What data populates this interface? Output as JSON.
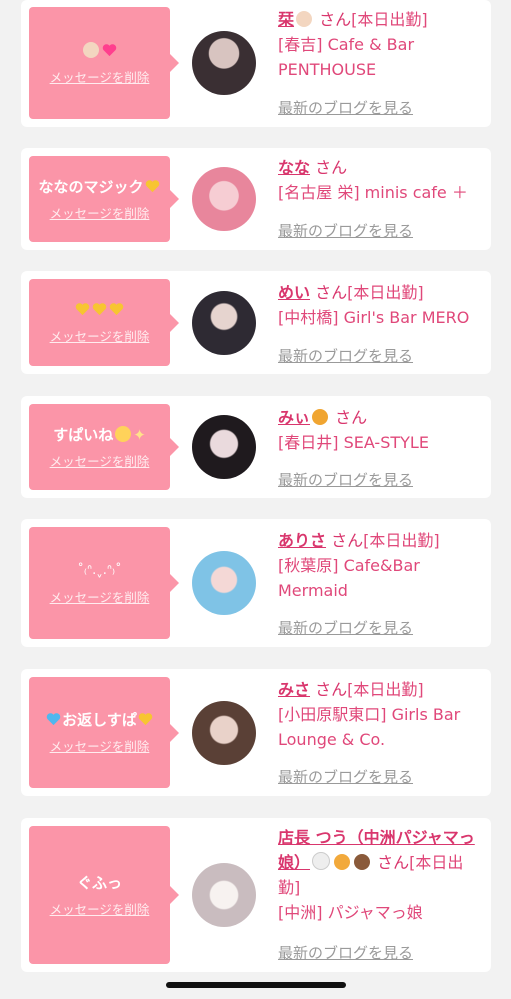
{
  "delete_label": "メッセージを削除",
  "blog_label": "最新のブログを見る",
  "san": "さん",
  "cards": [
    {
      "message": "",
      "name": "栞",
      "status": "[本日出勤]",
      "shop": "[春吉] Cafe & Bar PENTHOUSE"
    },
    {
      "message": "ななのマジック",
      "name": "なな",
      "status": "",
      "shop": "[名古屋 栄] minis cafe ＋"
    },
    {
      "message": "",
      "name": "めい",
      "status": "[本日出勤]",
      "shop": "[中村橋] Girl's Bar MERO"
    },
    {
      "message": "すぱいね",
      "name": "みぃ",
      "status": "",
      "shop": "[春日井] SEA-STYLE"
    },
    {
      "message": "˚₍ᐢ.ˬ.ᐢ₎˚",
      "name": "ありさ",
      "status": "[本日出勤]",
      "shop": "[秋葉原] Cafe&Bar Mermaid"
    },
    {
      "message": "お返しすぱ",
      "name": "みさ",
      "status": "[本日出勤]",
      "shop": "[小田原駅東口] Girls Bar Lounge & Co."
    },
    {
      "message": "ぐふっ",
      "name": "店長 つう（中洲パジャマっ娘）",
      "status": "[本日出勤]",
      "shop": "[中洲] パジャマっ娘"
    }
  ]
}
